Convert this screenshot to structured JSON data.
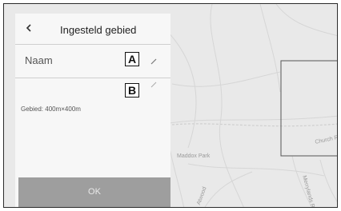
{
  "header": {
    "title": "Ingesteld gebied",
    "back_icon": "chevron-left-icon"
  },
  "name_row": {
    "label": "Naam",
    "edit_icon": "pencil-icon"
  },
  "area_row": {
    "label": "Gebied: 400m×400m",
    "edit_icon": "pencil-icon"
  },
  "callouts": {
    "a": "A",
    "b": "B"
  },
  "ok_button": {
    "label": "OK"
  },
  "map": {
    "street_labels": [
      "Maddox Park",
      "Church Ro",
      "Atwood",
      "Merrylands Ro"
    ]
  },
  "colors": {
    "panel_bg": "#f7f7f7",
    "map_bg": "#e9e9e9",
    "ok_bg": "#9e9e9e",
    "callout_border": "#111111"
  }
}
